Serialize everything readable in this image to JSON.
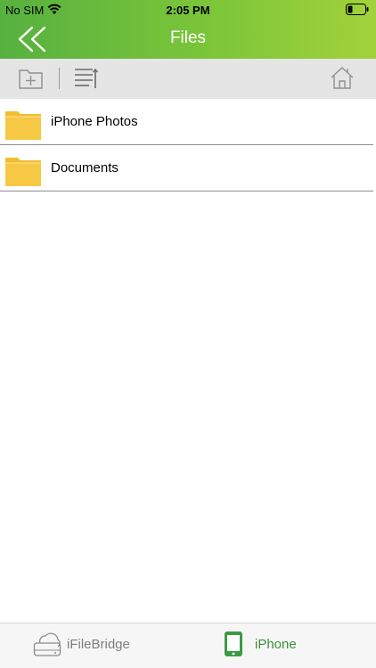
{
  "status_bar": {
    "carrier": "No SIM",
    "time": "2:05 PM"
  },
  "nav": {
    "title": "Files",
    "back_icon": "double-chevron-left-icon"
  },
  "toolbar": {
    "new_folder_icon": "new-folder-icon",
    "sort_icon": "sort-list-icon",
    "home_icon": "home-icon"
  },
  "files": [
    {
      "name": "iPhone Photos",
      "icon": "folder-icon"
    },
    {
      "name": "Documents",
      "icon": "folder-icon"
    }
  ],
  "tabbar": {
    "tabs": [
      {
        "label": "iFileBridge",
        "icon": "drive-cloud-icon",
        "active": false
      },
      {
        "label": "iPhone",
        "icon": "phone-icon",
        "active": true
      }
    ]
  },
  "colors": {
    "header_start": "#56b13f",
    "header_end": "#a2d23a",
    "toolbar_bg": "#e5e5e5",
    "folder_yellow": "#f7c843",
    "active_tab": "#3c8f3c",
    "inactive_tab": "#7f7f7f"
  }
}
